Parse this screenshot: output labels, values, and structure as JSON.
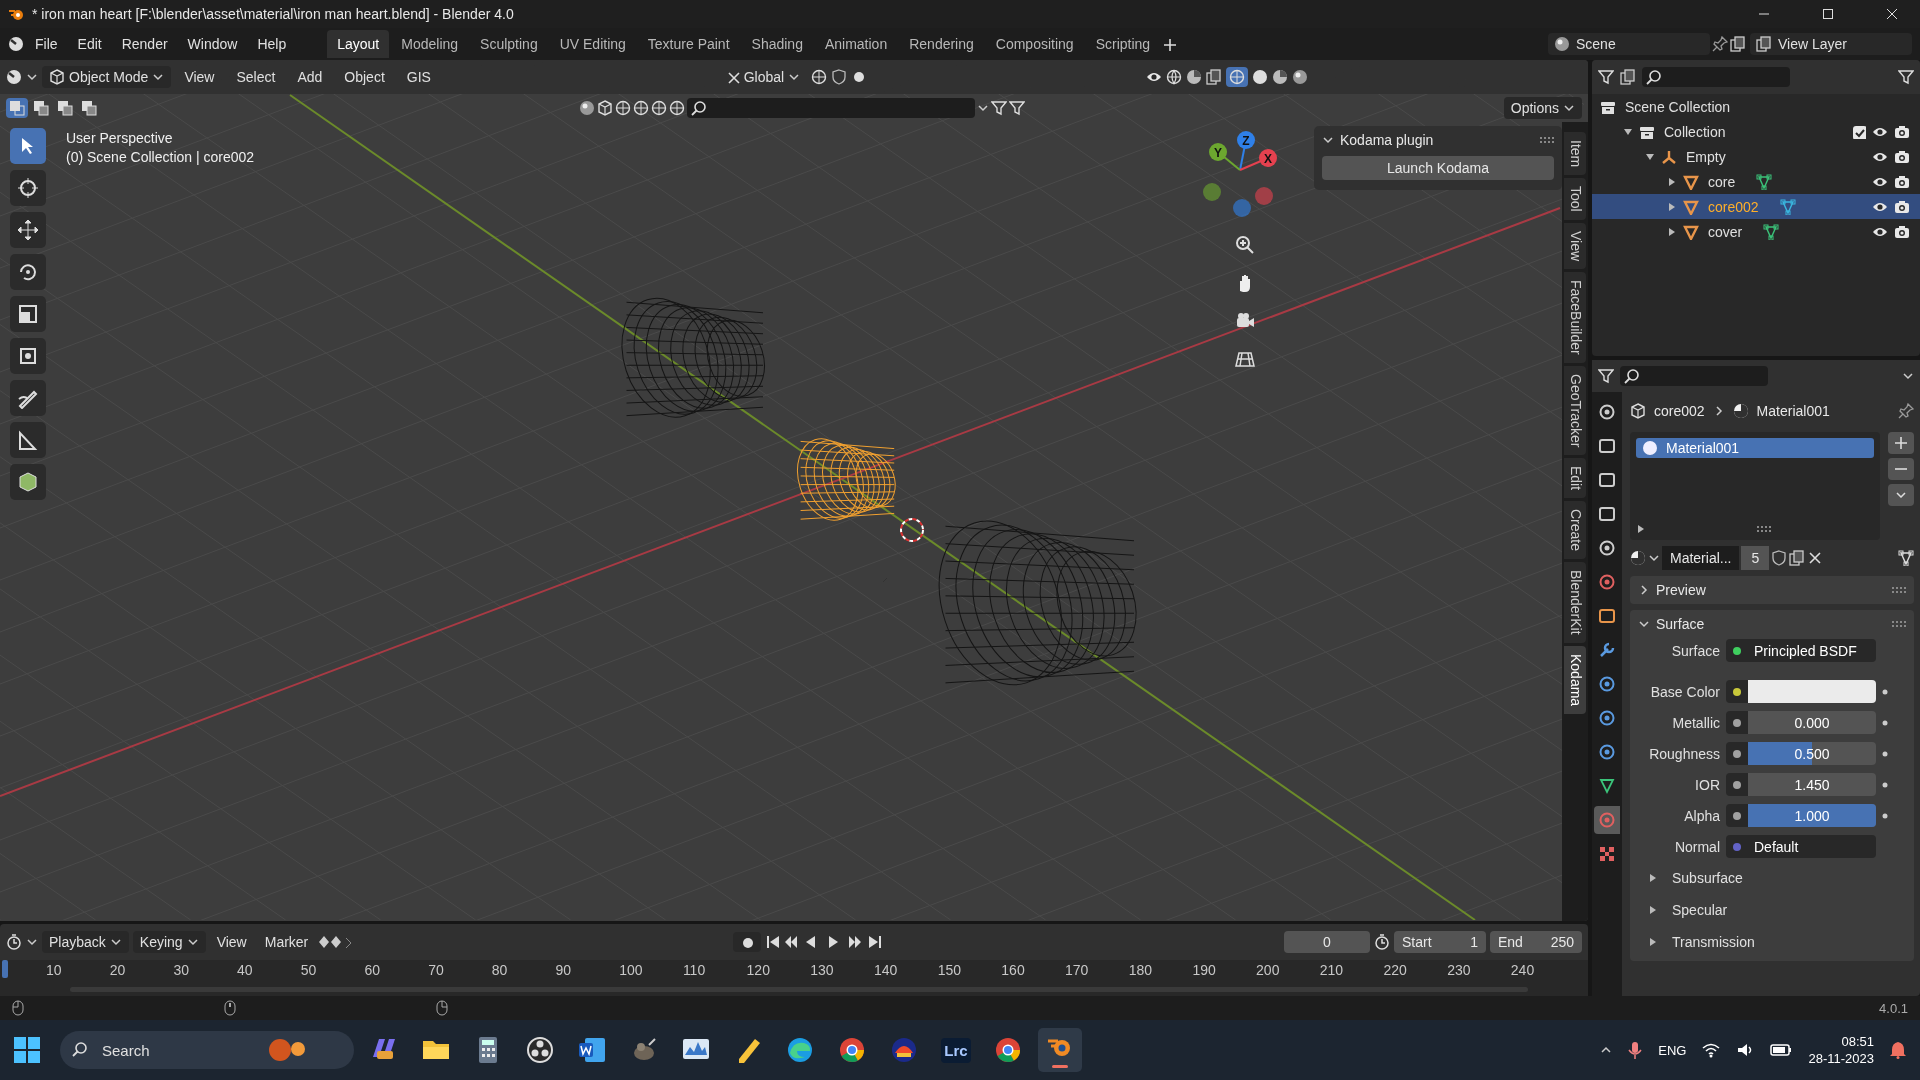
{
  "window": {
    "title": "* iron man heart [F:\\blender\\asset\\material\\iron man heart.blend] - Blender 4.0"
  },
  "menu": [
    "File",
    "Edit",
    "Render",
    "Window",
    "Help"
  ],
  "workspaces": [
    {
      "label": "Layout",
      "selected": true
    },
    {
      "label": "Modeling",
      "selected": false
    },
    {
      "label": "Sculpting",
      "selected": false
    },
    {
      "label": "UV Editing",
      "selected": false
    },
    {
      "label": "Texture Paint",
      "selected": false
    },
    {
      "label": "Shading",
      "selected": false
    },
    {
      "label": "Animation",
      "selected": false
    },
    {
      "label": "Rendering",
      "selected": false
    },
    {
      "label": "Compositing",
      "selected": false
    },
    {
      "label": "Scripting",
      "selected": false
    }
  ],
  "scene": {
    "name": "Scene"
  },
  "view_layer": {
    "name": "View Layer"
  },
  "viewport": {
    "mode": "Object Mode",
    "menus": [
      "View",
      "Select",
      "Add",
      "Object",
      "GIS"
    ],
    "orientation": "Global",
    "options": "Options",
    "info": [
      "User Perspective",
      "(0) Scene Collection | core002"
    ],
    "gizmo": [
      {
        "label": "Z",
        "color": "#2f80e8"
      },
      {
        "label": "Y",
        "color": "#6ca72f"
      },
      {
        "label": "X",
        "color": "#e5414f"
      }
    ],
    "panel": {
      "title": "Kodama plugin",
      "expanded": true,
      "button": "Launch Kodama"
    },
    "tabs": [
      {
        "label": "Item",
        "selected": false
      },
      {
        "label": "Tool",
        "selected": false
      },
      {
        "label": "View",
        "selected": false
      },
      {
        "label": "FaceBuilder",
        "selected": false
      },
      {
        "label": "GeoTracker",
        "selected": false
      },
      {
        "label": "Edit",
        "selected": false
      },
      {
        "label": "Create",
        "selected": false
      },
      {
        "label": "BlenderKit",
        "selected": false
      },
      {
        "label": "Kodama",
        "selected": true
      }
    ]
  },
  "outliner": {
    "items": [
      {
        "label": "Scene Collection",
        "kind": "scene",
        "selected": false,
        "children": [
          {
            "label": "Collection",
            "kind": "collection",
            "selected": false,
            "expanded": true,
            "checked": true,
            "children": [
              {
                "label": "Empty",
                "kind": "empty",
                "selected": false,
                "expanded": true,
                "children": [
                  {
                    "label": "core",
                    "kind": "mesh",
                    "selected": false,
                    "expanded": false
                  },
                  {
                    "label": "core002",
                    "kind": "mesh",
                    "selected": true,
                    "expanded": false
                  },
                  {
                    "label": "cover",
                    "kind": "mesh",
                    "selected": false,
                    "expanded": false
                  }
                ]
              }
            ]
          }
        ]
      }
    ]
  },
  "properties": {
    "tabs": [
      {
        "kind": "tool",
        "selected": false
      },
      {
        "kind": "render",
        "selected": false
      },
      {
        "kind": "output",
        "selected": false
      },
      {
        "kind": "view_layer",
        "selected": false
      },
      {
        "kind": "scene",
        "selected": false
      },
      {
        "kind": "world",
        "selected": false
      },
      {
        "kind": "object",
        "selected": false
      },
      {
        "kind": "modifier",
        "selected": false
      },
      {
        "kind": "particles",
        "selected": false
      },
      {
        "kind": "physics",
        "selected": false
      },
      {
        "kind": "constraints",
        "selected": false
      },
      {
        "kind": "data",
        "selected": false
      },
      {
        "kind": "material",
        "selected": true
      },
      {
        "kind": "texture",
        "selected": false
      }
    ],
    "breadcrumb": [
      "core002",
      "Material001"
    ],
    "slots": [
      {
        "label": "Material001",
        "selected": true
      }
    ],
    "datablock": {
      "name": "Material...",
      "users": "5"
    },
    "panels": [
      {
        "label": "Preview",
        "expanded": false
      },
      {
        "label": "Surface",
        "expanded": true
      }
    ],
    "fields": [
      {
        "label": "Surface",
        "kind": "shader",
        "value": "Principled BSDF",
        "color": "#3fcf5f"
      },
      {
        "label": "Base Color",
        "kind": "color",
        "color": "#c8c83a"
      },
      {
        "label": "Metallic",
        "kind": "slider",
        "value": "0.000",
        "level": 0,
        "color": "#a1a1a1"
      },
      {
        "label": "Roughness",
        "kind": "slider",
        "value": "0.500",
        "level": 0.5,
        "color": "#a1a1a1"
      },
      {
        "label": "IOR",
        "kind": "number",
        "value": "1.450",
        "color": "#a1a1a1"
      },
      {
        "label": "Alpha",
        "kind": "slider",
        "value": "1.000",
        "level": 1,
        "color": "#a1a1a1"
      },
      {
        "label": "Normal",
        "kind": "vector",
        "value": "Default",
        "color": "#6363c7"
      }
    ],
    "subpanels": [
      {
        "label": "Subsurface",
        "expanded": false
      },
      {
        "label": "Specular",
        "expanded": false
      },
      {
        "label": "Transmission",
        "expanded": false
      }
    ]
  },
  "timeline": {
    "menus": [
      {
        "label": "Playback",
        "dropdown": true
      },
      {
        "label": "Keying",
        "dropdown": true
      },
      {
        "label": "View",
        "dropdown": false
      },
      {
        "label": "Marker",
        "dropdown": false
      }
    ],
    "current": "0",
    "start": {
      "label": "Start",
      "value": "1"
    },
    "end": {
      "label": "End",
      "value": "250"
    },
    "ticks": [
      "10",
      "20",
      "30",
      "40",
      "50",
      "60",
      "70",
      "80",
      "90",
      "100",
      "110",
      "120",
      "130",
      "140",
      "150",
      "160",
      "170",
      "180",
      "190",
      "200",
      "210",
      "220",
      "230",
      "240"
    ]
  },
  "status_bar": {
    "version": "4.0.1"
  },
  "taskbar": {
    "search": {
      "placeholder": "Search"
    },
    "apps": [
      {
        "kind": "copilot",
        "selected": false
      },
      {
        "kind": "folder",
        "selected": false
      },
      {
        "kind": "calculator",
        "selected": false
      },
      {
        "kind": "obs",
        "selected": false
      },
      {
        "kind": "word",
        "selected": false
      },
      {
        "kind": "gimp",
        "selected": false
      },
      {
        "kind": "monitor",
        "selected": false
      },
      {
        "kind": "notes",
        "selected": false
      },
      {
        "kind": "edge",
        "selected": false
      },
      {
        "kind": "chrome",
        "selected": false
      },
      {
        "kind": "creative",
        "selected": false
      },
      {
        "kind": "lightroom",
        "label": "Lrc",
        "selected": false
      },
      {
        "kind": "chrome",
        "selected": false
      },
      {
        "kind": "blender",
        "selected": true
      }
    ],
    "language": "ENG",
    "time": "08:51",
    "date": "28-11-2023"
  }
}
